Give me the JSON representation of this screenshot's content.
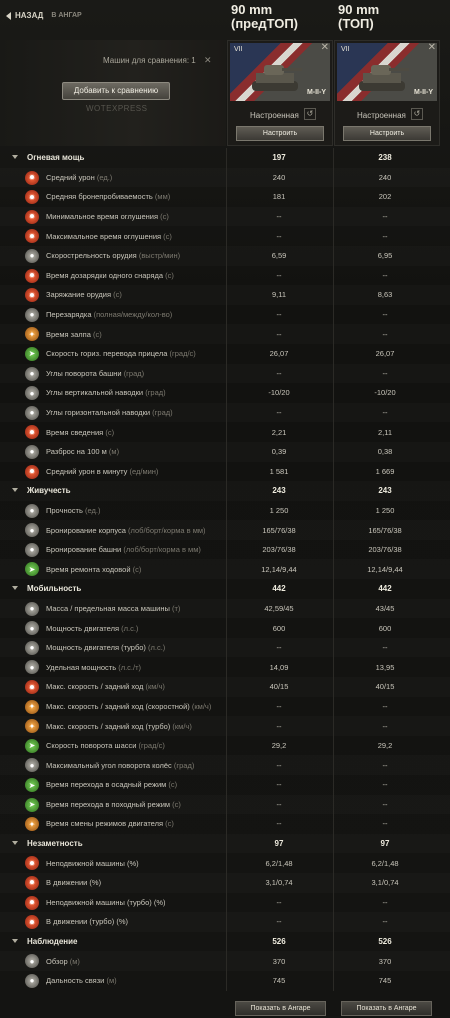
{
  "header": {
    "back_label": "НАЗАД",
    "back_sub": "В АНГАР",
    "col1_title_line1": "90 mm",
    "col1_title_line2": "(предТОП)",
    "col2_title_line1": "90 mm",
    "col2_title_line2": "(ТОП)"
  },
  "compare": {
    "label": "Машин для сравнения: 1",
    "add_button": "Добавить к сравнению",
    "watermark": "WOTEXPRESS"
  },
  "cards": [
    {
      "tier": "VII",
      "name": "M-II-Y",
      "state": "Настроенная",
      "configure": "Настроить"
    },
    {
      "tier": "VII",
      "name": "M-II-Y",
      "state": "Настроенная",
      "configure": "Настроить"
    }
  ],
  "rows": [
    {
      "type": "section",
      "label": "Огневая мощь",
      "v1": "197",
      "v2": "238"
    },
    {
      "type": "stat",
      "icon": "average-damage-icon",
      "color": "red",
      "label": "Средний урон",
      "unit": "(ед.)",
      "v1": "240",
      "v2": "240"
    },
    {
      "type": "stat",
      "icon": "penetration-icon",
      "color": "red",
      "label": "Средняя бронепробиваемость",
      "unit": "(мм)",
      "v1": "181",
      "v2": "202"
    },
    {
      "type": "stat",
      "icon": "min-stun-icon",
      "color": "red",
      "label": "Минимальное время оглушения",
      "unit": "(с)",
      "v1": "--",
      "v2": "--"
    },
    {
      "type": "stat",
      "icon": "max-stun-icon",
      "color": "red",
      "label": "Максимальное время оглушения",
      "unit": "(с)",
      "v1": "--",
      "v2": "--"
    },
    {
      "type": "stat",
      "icon": "rate-of-fire-icon",
      "color": "grey",
      "label": "Скорострельность орудия",
      "unit": "(выстр/мин)",
      "v1": "6,59",
      "v2": "6,95"
    },
    {
      "type": "stat",
      "icon": "autoreload-icon",
      "color": "red",
      "label": "Время дозарядки одного снаряда",
      "unit": "(с)",
      "v1": "--",
      "v2": "--"
    },
    {
      "type": "stat",
      "icon": "reload-icon",
      "color": "red",
      "label": "Заряжание орудия",
      "unit": "(с)",
      "v1": "9,11",
      "v2": "8,63"
    },
    {
      "type": "stat",
      "icon": "magazine-reload-icon",
      "color": "grey",
      "label": "Перезарядка",
      "unit": "(полная/между/кол-во)",
      "v1": "--",
      "v2": "--"
    },
    {
      "type": "stat",
      "icon": "salvo-time-icon",
      "color": "orange",
      "label": "Время залпа",
      "unit": "(с)",
      "v1": "--",
      "v2": "--"
    },
    {
      "type": "stat",
      "icon": "gun-traverse-icon",
      "color": "green",
      "label": "Скорость гориз. перевода прицела",
      "unit": "(град/с)",
      "v1": "26,07",
      "v2": "26,07"
    },
    {
      "type": "stat",
      "icon": "turret-angles-icon",
      "color": "grey",
      "label": "Углы поворота башни",
      "unit": "(град)",
      "v1": "--",
      "v2": "--"
    },
    {
      "type": "stat",
      "icon": "elevation-icon",
      "color": "grey",
      "label": "Углы вертикальной наводки",
      "unit": "(град)",
      "v1": "-10/20",
      "v2": "-10/20"
    },
    {
      "type": "stat",
      "icon": "horizontal-angles-icon",
      "color": "grey",
      "label": "Углы горизонтальной наводки",
      "unit": "(град)",
      "v1": "--",
      "v2": "--"
    },
    {
      "type": "stat",
      "icon": "aim-time-icon",
      "color": "red",
      "label": "Время сведения",
      "unit": "(с)",
      "v1": "2,21",
      "v2": "2,11"
    },
    {
      "type": "stat",
      "icon": "dispersion-icon",
      "color": "grey",
      "label": "Разброс на 100 м",
      "unit": "(м)",
      "v1": "0,39",
      "v2": "0,38"
    },
    {
      "type": "stat",
      "icon": "dpm-icon",
      "color": "red",
      "label": "Средний урон в минуту",
      "unit": "(ед/мин)",
      "v1": "1 581",
      "v2": "1 669"
    },
    {
      "type": "section",
      "label": "Живучесть",
      "v1": "243",
      "v2": "243"
    },
    {
      "type": "stat",
      "icon": "hitpoints-icon",
      "color": "grey",
      "label": "Прочность",
      "unit": "(ед.)",
      "v1": "1 250",
      "v2": "1 250"
    },
    {
      "type": "stat",
      "icon": "hull-armor-icon",
      "color": "grey",
      "label": "Бронирование корпуса",
      "unit": "(лоб/борт/корма в мм)",
      "v1": "165/76/38",
      "v2": "165/76/38"
    },
    {
      "type": "stat",
      "icon": "turret-armor-icon",
      "color": "grey",
      "label": "Бронирование башни",
      "unit": "(лоб/борт/корма в мм)",
      "v1": "203/76/38",
      "v2": "203/76/38"
    },
    {
      "type": "stat",
      "icon": "track-repair-icon",
      "color": "green",
      "label": "Время ремонта ходовой",
      "unit": "(с)",
      "v1": "12,14/9,44",
      "v2": "12,14/9,44"
    },
    {
      "type": "section",
      "label": "Мобильность",
      "v1": "442",
      "v2": "442"
    },
    {
      "type": "stat",
      "icon": "weight-icon",
      "color": "grey",
      "label": "Масса / предельная масса машины",
      "unit": "(т)",
      "v1": "42,59/45",
      "v2": "43/45"
    },
    {
      "type": "stat",
      "icon": "engine-power-icon",
      "color": "grey",
      "label": "Мощность двигателя",
      "unit": "(л.с.)",
      "v1": "600",
      "v2": "600"
    },
    {
      "type": "stat",
      "icon": "engine-turbo-icon",
      "color": "grey",
      "label": "Мощность двигателя (турбо)",
      "unit": "(л.с.)",
      "v1": "--",
      "v2": "--"
    },
    {
      "type": "stat",
      "icon": "specific-power-icon",
      "color": "grey",
      "label": "Удельная мощность",
      "unit": "(л.с./т)",
      "v1": "14,09",
      "v2": "13,95"
    },
    {
      "type": "stat",
      "icon": "speed-icon",
      "color": "red",
      "label": "Макс. скорость / задний ход",
      "unit": "(км/ч)",
      "v1": "40/15",
      "v2": "40/15"
    },
    {
      "type": "stat",
      "icon": "speed-fast-icon",
      "color": "orange",
      "label": "Макс. скорость / задний ход (скоростной)",
      "unit": "(км/ч)",
      "v1": "--",
      "v2": "--"
    },
    {
      "type": "stat",
      "icon": "speed-turbo-icon",
      "color": "orange",
      "label": "Макс. скорость / задний ход (турбо)",
      "unit": "(км/ч)",
      "v1": "--",
      "v2": "--"
    },
    {
      "type": "stat",
      "icon": "hull-traverse-icon",
      "color": "green",
      "label": "Скорость поворота шасси",
      "unit": "(град/с)",
      "v1": "29,2",
      "v2": "29,2"
    },
    {
      "type": "stat",
      "icon": "wheel-angle-icon",
      "color": "grey",
      "label": "Максимальный угол поворота колёс",
      "unit": "(град)",
      "v1": "--",
      "v2": "--"
    },
    {
      "type": "stat",
      "icon": "siege-mode-icon",
      "color": "green",
      "label": "Время перехода в осадный режим",
      "unit": "(с)",
      "v1": "--",
      "v2": "--"
    },
    {
      "type": "stat",
      "icon": "travel-mode-icon",
      "color": "green",
      "label": "Время перехода в походный режим",
      "unit": "(с)",
      "v1": "--",
      "v2": "--"
    },
    {
      "type": "stat",
      "icon": "engine-mode-icon",
      "color": "orange",
      "label": "Время смены режимов двигателя",
      "unit": "(с)",
      "v1": "--",
      "v2": "--"
    },
    {
      "type": "section",
      "label": "Незаметность",
      "v1": "97",
      "v2": "97"
    },
    {
      "type": "stat",
      "icon": "camo-stationary-icon",
      "color": "red",
      "label": "Неподвижной машины (%)",
      "unit": "",
      "v1": "6,2/1,48",
      "v2": "6,2/1,48"
    },
    {
      "type": "stat",
      "icon": "camo-moving-icon",
      "color": "red",
      "label": "В движении (%)",
      "unit": "",
      "v1": "3,1/0,74",
      "v2": "3,1/0,74"
    },
    {
      "type": "stat",
      "icon": "camo-stationary-turbo-icon",
      "color": "red",
      "label": "Неподвижной машины (турбо) (%)",
      "unit": "",
      "v1": "--",
      "v2": "--"
    },
    {
      "type": "stat",
      "icon": "camo-moving-turbo-icon",
      "color": "red",
      "label": "В движении (турбо) (%)",
      "unit": "",
      "v1": "--",
      "v2": "--"
    },
    {
      "type": "section",
      "label": "Наблюдение",
      "v1": "526",
      "v2": "526"
    },
    {
      "type": "stat",
      "icon": "view-range-icon",
      "color": "grey",
      "label": "Обзор",
      "unit": "(м)",
      "v1": "370",
      "v2": "370"
    },
    {
      "type": "stat",
      "icon": "radio-range-icon",
      "color": "grey",
      "label": "Дальность связи",
      "unit": "(м)",
      "v1": "745",
      "v2": "745"
    }
  ],
  "footer": {
    "show_in_hangar_1": "Показать в Ангаре",
    "show_in_hangar_2": "Показать в Ангаре"
  }
}
